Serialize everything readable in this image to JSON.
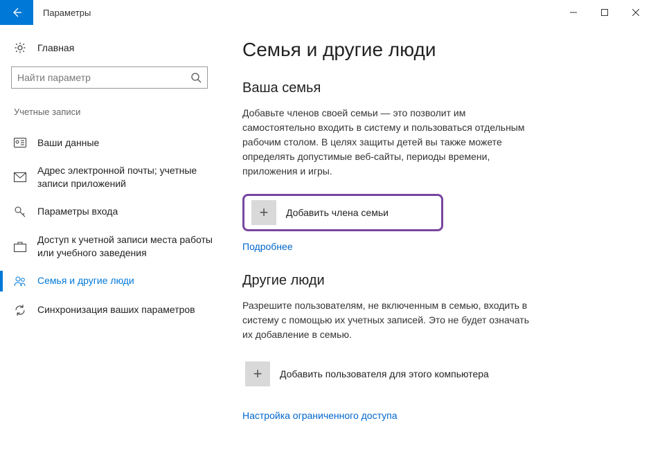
{
  "titlebar": {
    "title": "Параметры"
  },
  "sidebar": {
    "home": "Главная",
    "search_placeholder": "Найти параметр",
    "category": "Учетные записи",
    "items": [
      {
        "label": "Ваши данные"
      },
      {
        "label": "Адрес электронной почты; учетные записи приложений"
      },
      {
        "label": "Параметры входа"
      },
      {
        "label": "Доступ к учетной записи места работы или учебного заведения"
      },
      {
        "label": "Семья и другие люди"
      },
      {
        "label": "Синхронизация ваших параметров"
      }
    ]
  },
  "content": {
    "heading": "Семья и другие люди",
    "family": {
      "title": "Ваша семья",
      "body": "Добавьте членов своей семьи — это позволит им самостоятельно входить в систему и пользоваться отдельным рабочим столом. В целях защиты детей вы также можете определять допустимые веб-сайты, периоды времени, приложения и игры.",
      "add_label": "Добавить члена семьи",
      "more": "Подробнее"
    },
    "others": {
      "title": "Другие люди",
      "body": "Разрешите пользователям, не включенным в семью, входить в систему с помощью их учетных записей. Это не будет означать их добавление в семью.",
      "add_label": "Добавить пользователя для этого компьютера",
      "assigned": "Настройка ограниченного доступа"
    }
  }
}
